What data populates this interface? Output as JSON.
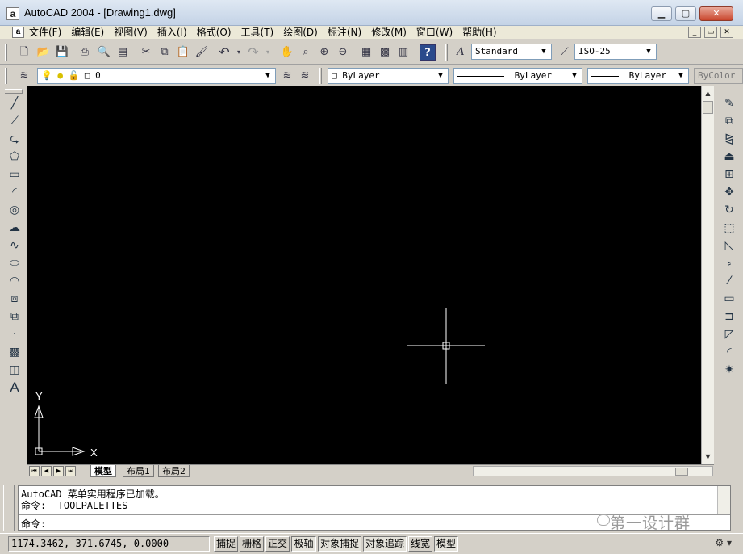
{
  "window": {
    "app_icon": "a",
    "title": "AutoCAD 2004 - [Drawing1.dwg]",
    "minimize": "▁",
    "maximize": "▢",
    "close": "✕"
  },
  "menubar": {
    "icon": "a",
    "items": [
      "文件(F)",
      "编辑(E)",
      "视图(V)",
      "插入(I)",
      "格式(O)",
      "工具(T)",
      "绘图(D)",
      "标注(N)",
      "修改(M)",
      "窗口(W)",
      "帮助(H)"
    ],
    "mdi_minimize": "_",
    "mdi_restore": "▭",
    "mdi_close": "✕"
  },
  "standard_toolbar": {
    "text_style": "Standard",
    "dim_style": "ISO-25"
  },
  "layers_toolbar": {
    "layer_name": "0",
    "color": "ByLayer",
    "linetype": "ByLayer",
    "lineweight": "ByLayer",
    "plotstyle": "ByColor"
  },
  "draw_tools": [
    "line-icon",
    "construction-line-icon",
    "polyline-icon",
    "polygon-icon",
    "rectangle-icon",
    "arc-icon",
    "circle-icon",
    "revision-cloud-icon",
    "spline-icon",
    "ellipse-icon",
    "ellipse-arc-icon",
    "insert-block-icon",
    "make-block-icon",
    "point-icon",
    "hatch-icon",
    "region-icon",
    "multiline-text-icon"
  ],
  "modify_tools": [
    "erase-icon",
    "copy-icon",
    "mirror-icon",
    "offset-icon",
    "array-icon",
    "move-icon",
    "rotate-icon",
    "scale-icon",
    "stretch-icon",
    "trim-icon",
    "extend-icon",
    "break-icon",
    "join-icon",
    "chamfer-icon",
    "fillet-icon",
    "explode-icon"
  ],
  "canvas": {
    "background": "#000000",
    "ucs_x_label": "X",
    "ucs_y_label": "Y"
  },
  "layout_tabs": [
    "模型",
    "布局1",
    "布局2"
  ],
  "active_layout": "模型",
  "command": {
    "history": [
      "AutoCAD 菜单实用程序已加载。",
      "命令:  TOOLPALETTES"
    ],
    "prompt": "命令:"
  },
  "status": {
    "coordinates": "1174.3462, 371.6745, 0.0000",
    "buttons": [
      {
        "label": "捕捉",
        "on": false
      },
      {
        "label": "栅格",
        "on": false
      },
      {
        "label": "正交",
        "on": false
      },
      {
        "label": "极轴",
        "on": true
      },
      {
        "label": "对象捕捉",
        "on": true
      },
      {
        "label": "对象追踪",
        "on": true
      },
      {
        "label": "线宽",
        "on": false
      },
      {
        "label": "模型",
        "on": true
      }
    ]
  },
  "watermark": "第一设计群"
}
